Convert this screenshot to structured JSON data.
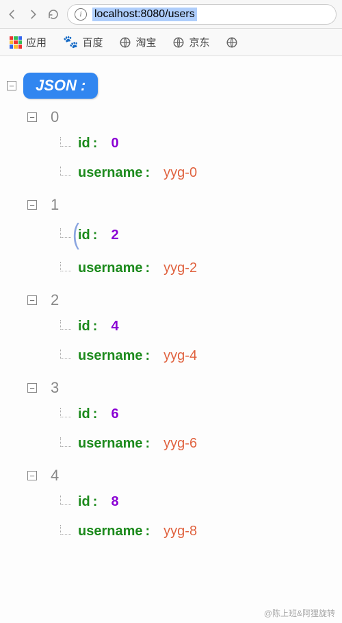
{
  "toolbar": {
    "url": "localhost:8080/users"
  },
  "bookmarks": {
    "apps": "应用",
    "baidu": "百度",
    "taobao": "淘宝",
    "jd": "京东"
  },
  "json_viewer": {
    "root_label": "JSON :",
    "key_id": "id",
    "key_username": "username",
    "entries": [
      {
        "index": "0",
        "id": "0",
        "username": "yyg-0"
      },
      {
        "index": "1",
        "id": "2",
        "username": "yyg-2"
      },
      {
        "index": "2",
        "id": "4",
        "username": "yyg-4"
      },
      {
        "index": "3",
        "id": "6",
        "username": "yyg-6"
      },
      {
        "index": "4",
        "id": "8",
        "username": "yyg-8"
      }
    ]
  },
  "watermark": "@陈上班&阿狸旋转"
}
